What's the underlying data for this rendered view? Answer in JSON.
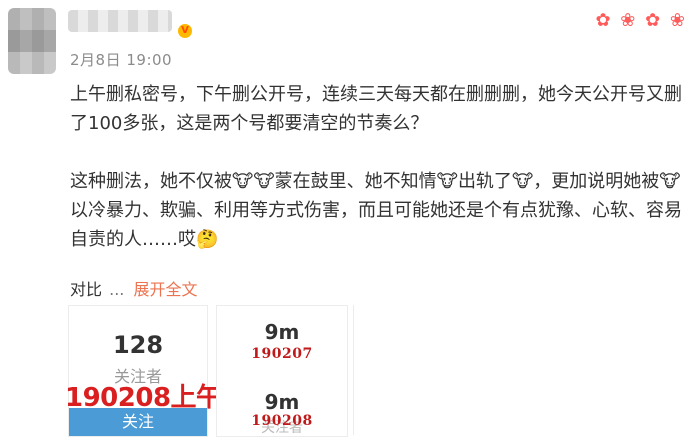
{
  "post": {
    "timestamp": "2月8日 19:00",
    "paragraph1": "上午删私密号，下午删公开号，连续三天每天都在删删删，她今天公开号又删了100多张，这是两个号都要清空的节奏么？",
    "paragraph2_a": "这种删法，她不仅被",
    "paragraph2_b": "蒙在鼓里、她不知情",
    "paragraph2_c": "出轨了",
    "paragraph2_d": "，更加说明她被",
    "paragraph2_e": "以冷暴力、欺骗、利用等方式伤害，而且可能她还是个有点犹豫、心软、容易自责的人……哎",
    "compare_label": "对比",
    "ellipsis": "...",
    "expand_label": "展开全文"
  },
  "cards": {
    "left": {
      "count": "128",
      "followers_label": "关注者",
      "overlay_text": "190208上午",
      "follow_button": "关注"
    },
    "middle": {
      "top_value": "9m",
      "top_code": "190207",
      "bottom_value": "9m",
      "bottom_code": "190208",
      "bottom_ghost_label": "关注者"
    }
  },
  "icons": {
    "avatar": "blurred-avatar",
    "vip": "vip-badge-icon",
    "decor": "decorative-sticker-icons",
    "emoji_cow": "cow-emoji-icon",
    "emoji_think": "thinking-emoji-icon"
  },
  "colors": {
    "accent_orange": "#eb7350",
    "follow_blue": "#4a9bd6",
    "overlay_red": "#d91f1f"
  }
}
